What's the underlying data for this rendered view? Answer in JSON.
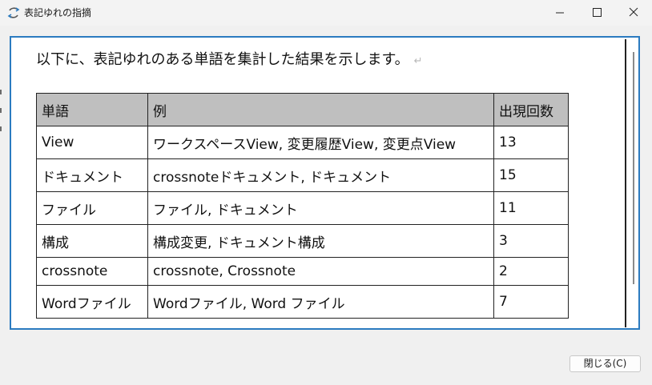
{
  "window": {
    "title": "表記ゆれの指摘",
    "minimize_icon": "minimize-icon",
    "maximize_icon": "maximize-icon",
    "close_icon": "close-icon",
    "accent_color": "#2b7bc0"
  },
  "content": {
    "intro_text": "以下に、表記ゆれのある単語を集計した結果を示します。",
    "paragraph_mark": "↵",
    "table": {
      "headers": [
        "単語",
        "例",
        "出現回数"
      ],
      "rows": [
        [
          "View",
          "ワークスペースView, 変更履歴View, 変更点View",
          "13"
        ],
        [
          "ドキュメント",
          "crossnoteドキュメント, ドキュメント",
          "15"
        ],
        [
          "ファイル",
          "ファイル, ドキュメント",
          "11"
        ],
        [
          "構成",
          "構成変更, ドキュメント構成",
          "3"
        ],
        [
          "crossnote",
          "crossnote, Crossnote",
          "2"
        ],
        [
          "Wordファイル",
          "Wordファイル, Word ファイル",
          "7"
        ]
      ]
    }
  },
  "footer": {
    "close_button_label": "閉じる(C)"
  }
}
